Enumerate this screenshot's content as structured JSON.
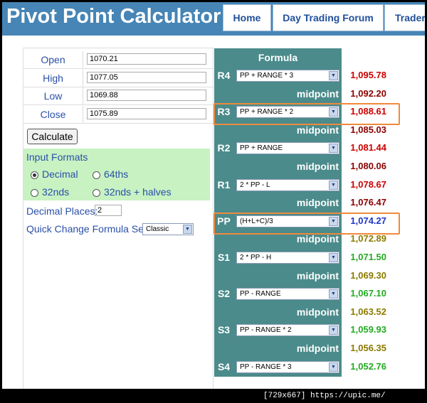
{
  "header": {
    "title": "Pivot Point Calculator",
    "nav": [
      "Home",
      "Day Trading Forum",
      "Traders"
    ]
  },
  "inputs": [
    {
      "label": "Open",
      "value": "1070.21"
    },
    {
      "label": "High",
      "value": "1077.05"
    },
    {
      "label": "Low",
      "value": "1069.88"
    },
    {
      "label": "Close",
      "value": "1075.89"
    }
  ],
  "calculate_label": "Calculate",
  "input_formats": {
    "title": "Input Formats",
    "options": [
      "Decimal",
      "64ths",
      "32nds",
      "32nds + halves"
    ],
    "selected": "Decimal"
  },
  "decimal_places": {
    "label": "Decimal Places:",
    "value": "2"
  },
  "quick_change": {
    "label": "Quick Change Formula Set:",
    "value": "Classic"
  },
  "formula_header": "Formula",
  "midpoint_label": "midpoint",
  "levels": [
    {
      "label": "R4",
      "formula": "PP + RANGE * 3",
      "value": "1,095.78",
      "color": "#cc0000"
    },
    {
      "label": "",
      "formula": "",
      "value": "1,092.20",
      "color": "#8b0000"
    },
    {
      "label": "R3",
      "formula": "PP + RANGE * 2",
      "value": "1,088.61",
      "color": "#cc0000"
    },
    {
      "label": "",
      "formula": "",
      "value": "1,085.03",
      "color": "#8b0000"
    },
    {
      "label": "R2",
      "formula": "PP + RANGE",
      "value": "1,081.44",
      "color": "#cc0000"
    },
    {
      "label": "",
      "formula": "",
      "value": "1,080.06",
      "color": "#8b0000"
    },
    {
      "label": "R1",
      "formula": "2 * PP - L",
      "value": "1,078.67",
      "color": "#cc0000"
    },
    {
      "label": "",
      "formula": "",
      "value": "1,076.47",
      "color": "#8b0000"
    },
    {
      "label": "PP",
      "formula": "(H+L+C)/3",
      "value": "1,074.27",
      "color": "#1d35c8"
    },
    {
      "label": "",
      "formula": "",
      "value": "1,072.89",
      "color": "#8b7a00"
    },
    {
      "label": "S1",
      "formula": "2 * PP - H",
      "value": "1,071.50",
      "color": "#22aa22"
    },
    {
      "label": "",
      "formula": "",
      "value": "1,069.30",
      "color": "#8b7a00"
    },
    {
      "label": "S2",
      "formula": "PP - RANGE",
      "value": "1,067.10",
      "color": "#22aa22"
    },
    {
      "label": "",
      "formula": "",
      "value": "1,063.52",
      "color": "#8b7a00"
    },
    {
      "label": "S3",
      "formula": "PP - RANGE * 2",
      "value": "1,059.93",
      "color": "#22aa22"
    },
    {
      "label": "",
      "formula": "",
      "value": "1,056.35",
      "color": "#8b7a00"
    },
    {
      "label": "S4",
      "formula": "PP - RANGE * 3",
      "value": "1,052.76",
      "color": "#22aa22"
    }
  ],
  "highlight_color": "#ef8a3c",
  "watermark": "[729x667] https://upic.me/"
}
